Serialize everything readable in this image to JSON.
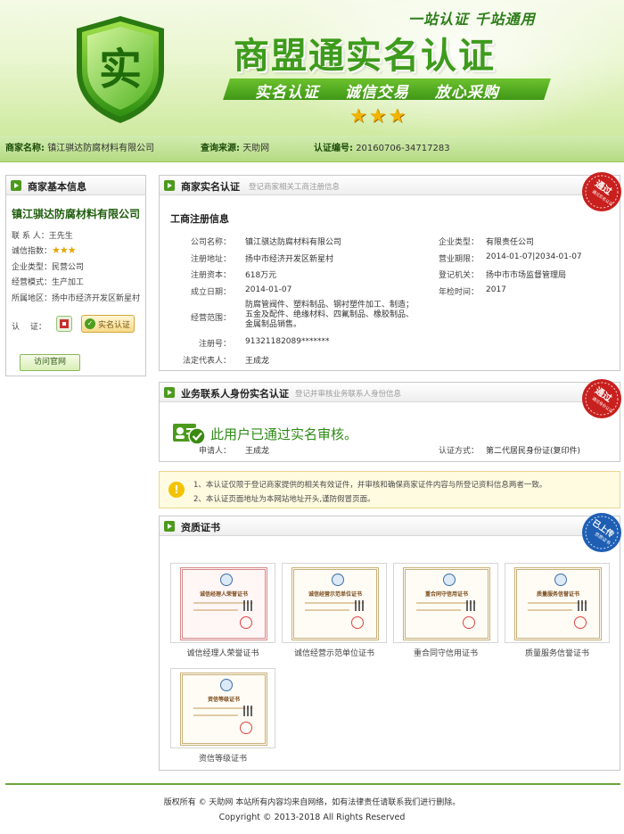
{
  "banner": {
    "slogan_top": "一站认证 千站通用",
    "title": "商盟通实名认证",
    "slogan_bar": [
      "实名认证",
      "诚信交易",
      "放心采购"
    ],
    "shield_char": "实",
    "stars": "★★★"
  },
  "strip": {
    "merchant_key": "商家名称:",
    "merchant_val": "镇江骐达防腐材料有限公司",
    "source_key": "查询来源:",
    "source_val": "天助网",
    "cert_key": "认证编号:",
    "cert_val": "20160706-34717283"
  },
  "left_panel": {
    "title": "商家基本信息",
    "company": "镇江骐达防腐材料有限公司",
    "contact_label": "联 系 人：",
    "contact": "王先生",
    "credit_label": "诚信指数：",
    "credit_stars": "★★★",
    "type_label": "企业类型：",
    "type": "民营公司",
    "mode_label": "经营模式：",
    "mode": "生产加工",
    "region_label": "所属地区：",
    "region": "扬中市经济开发区新星村",
    "cert_label": "认　 证：",
    "badge_text": "实名认证",
    "visit_button": "访问官网"
  },
  "real_name_panel": {
    "title": "商家实名认证",
    "subtitle": "登记商家相关工商注册信息",
    "ribbon": "通过",
    "ribbon_sub": "通过实名认证",
    "section": "工商注册信息",
    "left_fields": [
      {
        "label": "公司名称：",
        "value": "镇江骐达防腐材料有限公司"
      },
      {
        "label": "注册地址：",
        "value": "扬中市经济开发区新星村"
      },
      {
        "label": "注册资本：",
        "value": "618万元"
      },
      {
        "label": "成立日期：",
        "value": "2014-01-07"
      },
      {
        "label": "经营范围：",
        "value": "防腐管阀件、塑料制品、钢衬塑件加工、制造；五金及配件、绝缘材料、四氟制品、橡胶制品、金属制品销售。"
      },
      {
        "label": "注册号：",
        "value": "91321182089*******"
      },
      {
        "label": "法定代表人：",
        "value": "王成龙"
      }
    ],
    "right_fields": [
      {
        "label": "企业类型：",
        "value": "有限责任公司"
      },
      {
        "label": "营业期限：",
        "value": "2014-01-07|2034-01-07"
      },
      {
        "label": "登记机关：",
        "value": "扬中市市场监督管理局"
      },
      {
        "label": "年检时间：",
        "value": "2017"
      }
    ]
  },
  "identity_panel": {
    "title": "业务联系人身份实名认证",
    "subtitle": "登记并审核业务联系人身份信息",
    "ribbon": "通过",
    "ribbon_sub": "通过身份认证",
    "verified": "此用户已通过实名审核。",
    "applicant_label": "申请人：",
    "applicant": "王成龙",
    "method_label": "认证方式：",
    "method": "第二代居民身份证(复印件)"
  },
  "notice": {
    "lines": [
      "1、本认证仅限于登记商家提供的相关有效证件，并审核和确保商家证件内容与所登记资料信息两者一致。",
      "2、本认证页面地址为本网站地址开头,谨防假冒页面。"
    ]
  },
  "cert_panel": {
    "title": "资质证书",
    "ribbon": "已上传",
    "ribbon_sub": "资质证书",
    "certs": [
      {
        "caption": "诚信经理人荣誉证书",
        "doc_title": "诚信经理人荣誉证书"
      },
      {
        "caption": "诚信经营示范单位证书",
        "doc_title": "诚信经营示范单位证书"
      },
      {
        "caption": "重合同守信用证书",
        "doc_title": "重合同守信用证书"
      },
      {
        "caption": "质量服务信誉证书",
        "doc_title": "质量服务信誉证书"
      },
      {
        "caption": "资信等级证书",
        "doc_title": "资信等级证书"
      }
    ]
  },
  "footer": {
    "line1": "版权所有 © 天助网 本站所有内容均来自网络，如有法律责任请联系我们进行删除。",
    "line2": "Copyright © 2013-2018 All Rights Reserved"
  },
  "colors": {
    "brand_green": "#3e9b1c",
    "ribbon_red": "#c8201e",
    "ribbon_blue": "#1e5fb4",
    "star_gold": "#f2b400"
  }
}
